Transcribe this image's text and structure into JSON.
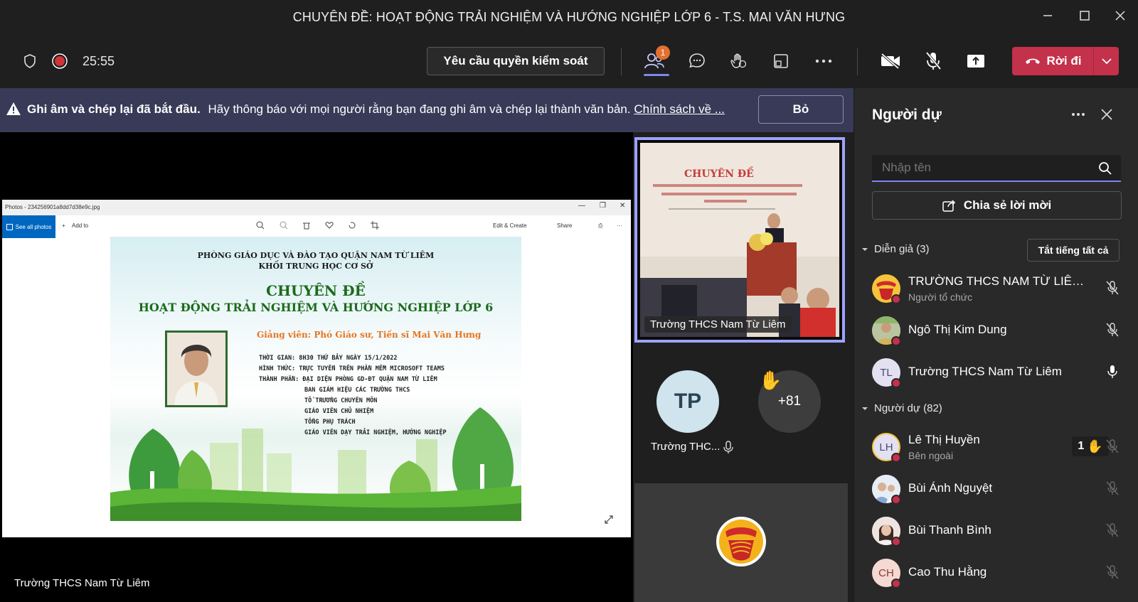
{
  "window": {
    "title": "CHUYÊN ĐỀ: HOẠT ĐỘNG TRẢI NGHIỆM VÀ HƯỚNG NGHIỆP LỚP 6 - T.S. MAI VĂN HƯNG"
  },
  "toolbar": {
    "timer": "25:55",
    "request_control_label": "Yêu cầu quyền kiểm soát",
    "participants_badge": "1",
    "leave_label": "Rời đi",
    "icons": [
      "shield-icon",
      "record-icon",
      "people-icon",
      "chat-icon",
      "raise-hand-icon",
      "rooms-icon",
      "more-icon",
      "camera-off-icon",
      "mic-off-icon",
      "share-icon",
      "hangup-icon",
      "chevron-down-icon"
    ]
  },
  "banner": {
    "bold_text": "Ghi âm và chép lại đã bắt đầu.",
    "text": "Hãy thông báo với mọi người rằng bạn đang ghi âm và chép lại thành văn bản.",
    "link_text": "Chính sách về ...",
    "dismiss_label": "Bỏ"
  },
  "stage": {
    "presenter_name": "Trường THCS Nam Từ Liêm",
    "photos": {
      "title": "Photos - 234256901a8dd7d38e9c.jpg",
      "see_all": "See all photos",
      "add_to": "Add to",
      "edit_create": "Edit & Create",
      "share": "Share"
    },
    "slide": {
      "org_line1": "PHÒNG GIÁO DỤC VÀ ĐÀO TẠO QUẬN NAM TỪ LIÊM",
      "org_line2": "KHỐI TRUNG HỌC CƠ SỞ",
      "heading": "CHUYÊN ĐỀ",
      "topic": "HOẠT ĐỘNG TRẢI NGHIỆM VÀ HƯỚNG NGHIỆP LỚP 6",
      "lecturer": "Giảng viên: Phó Giáo sư, Tiến sĩ Mai Văn Hưng",
      "info": [
        "THỜI GIAN: 8H30 THỨ BẢY NGÀY 15/1/2022",
        "HÌNH THỨC: TRỰC TUYẾN TRÊN PHẦN MỀM MICROSOFT TEAMS",
        "THÀNH PHẦN: ĐẠI DIỆN PHÒNG GD-ĐT QUẬN NAM TỪ LIÊM",
        "BAN GIÁM HIỆU CÁC TRƯỜNG THCS",
        "TỔ TRƯỞNG CHUYÊN MÔN",
        "GIÁO VIÊN CHỦ NHIỆM",
        "TỔNG PHỤ TRÁCH",
        "GIÁO VIÊN DẠY TRẢI NGHIỆM, HƯỚNG NGHIỆP"
      ]
    }
  },
  "tiles": {
    "pinned_name": "Trường THCS Nam Từ Liêm",
    "tp_initials": "TP",
    "tp_name": "Trường THC...",
    "overflow_count": "+81"
  },
  "panel": {
    "title": "Người dự",
    "search_placeholder": "Nhập tên",
    "invite_label": "Chia sẻ lời mời",
    "presenters_header": "Diễn giả (3)",
    "mute_all_label": "Tắt tiếng tất cả",
    "attendees_header": "Người dự (82)",
    "presenters": [
      {
        "name": "TRƯỜNG THCS NAM TỪ LIÊM - ...",
        "sub": "Người tổ chức",
        "mic": "mic-off-icon"
      },
      {
        "name": "Ngô Thị Kim Dung",
        "sub": "",
        "mic": "mic-off-icon"
      },
      {
        "name": "Trường THCS Nam Từ Liêm",
        "sub": "",
        "initials": "TL",
        "mic": "mic-on-icon"
      }
    ],
    "attendees": [
      {
        "name": "Lê Thị Huyền",
        "sub": "Bên ngoài",
        "initials": "LH",
        "hand_count": "1"
      },
      {
        "name": "Bùi Ánh Nguyệt",
        "sub": ""
      },
      {
        "name": "Bùi Thanh Bình",
        "sub": ""
      },
      {
        "name": "Cao Thu Hằng",
        "sub": "",
        "initials": "CH"
      }
    ]
  },
  "colors": {
    "accent": "#7f85f5",
    "leave": "#c4314b",
    "banner": "#383a58",
    "badge": "#e3702f"
  }
}
